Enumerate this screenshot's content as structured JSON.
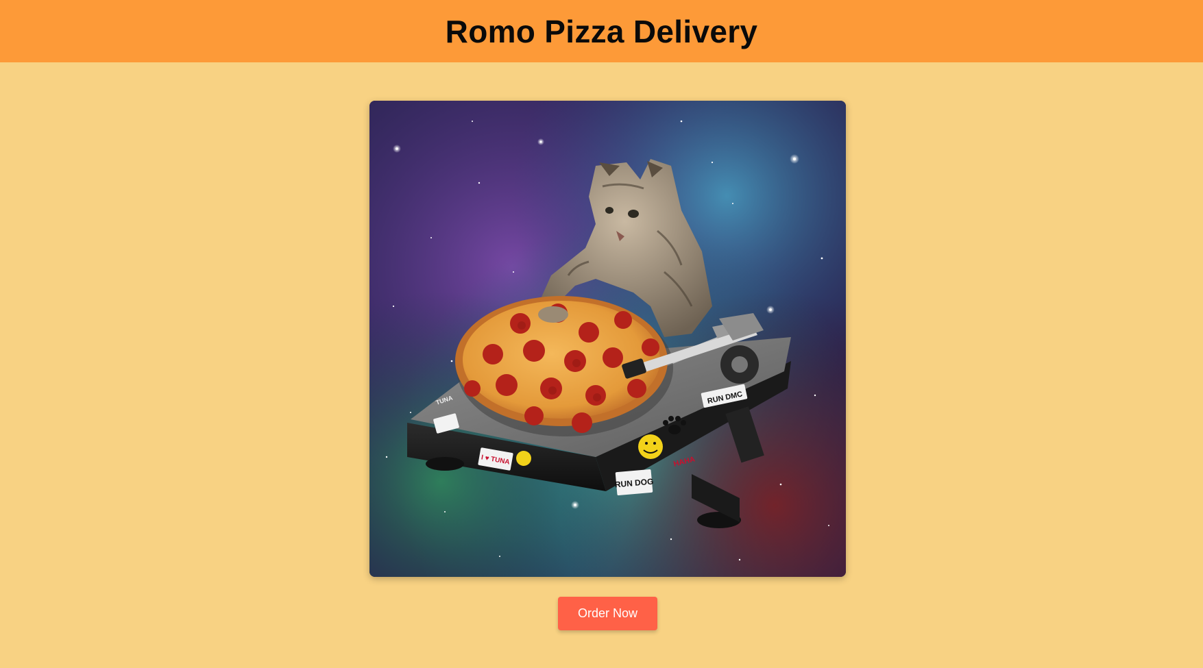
{
  "header": {
    "title": "Romo Pizza Delivery"
  },
  "hero": {
    "image_subject": "cat-dj-pizza-turntable-in-space",
    "sticker_texts": [
      "RUN DMC",
      "RUN DOG",
      "I ♥ TUNA",
      "TUNA",
      "HAHA"
    ]
  },
  "cta": {
    "order_label": "Order Now"
  },
  "colors": {
    "page_background": "#f8d283",
    "header_background": "#fd9a38",
    "button_background": "#ff6147",
    "button_text": "#ffffff",
    "title_text": "#0a0a0a"
  }
}
